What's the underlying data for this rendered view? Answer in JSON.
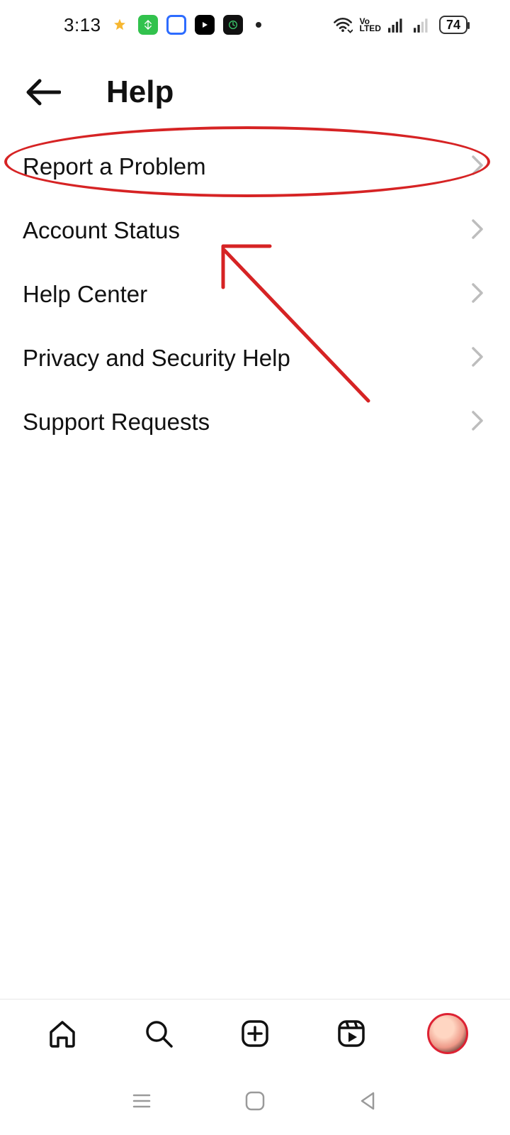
{
  "status": {
    "time": "3:13",
    "volte_top": "Vo",
    "volte_bottom": "LTED",
    "battery": "74"
  },
  "header": {
    "title": "Help"
  },
  "menu": {
    "items": [
      {
        "label": "Report a Problem"
      },
      {
        "label": "Account Status"
      },
      {
        "label": "Help Center"
      },
      {
        "label": "Privacy and Security Help"
      },
      {
        "label": "Support Requests"
      }
    ]
  },
  "annotation": {
    "highlighted_item_index": 0,
    "arrow_points_to_index": 0,
    "color": "#d62324"
  }
}
